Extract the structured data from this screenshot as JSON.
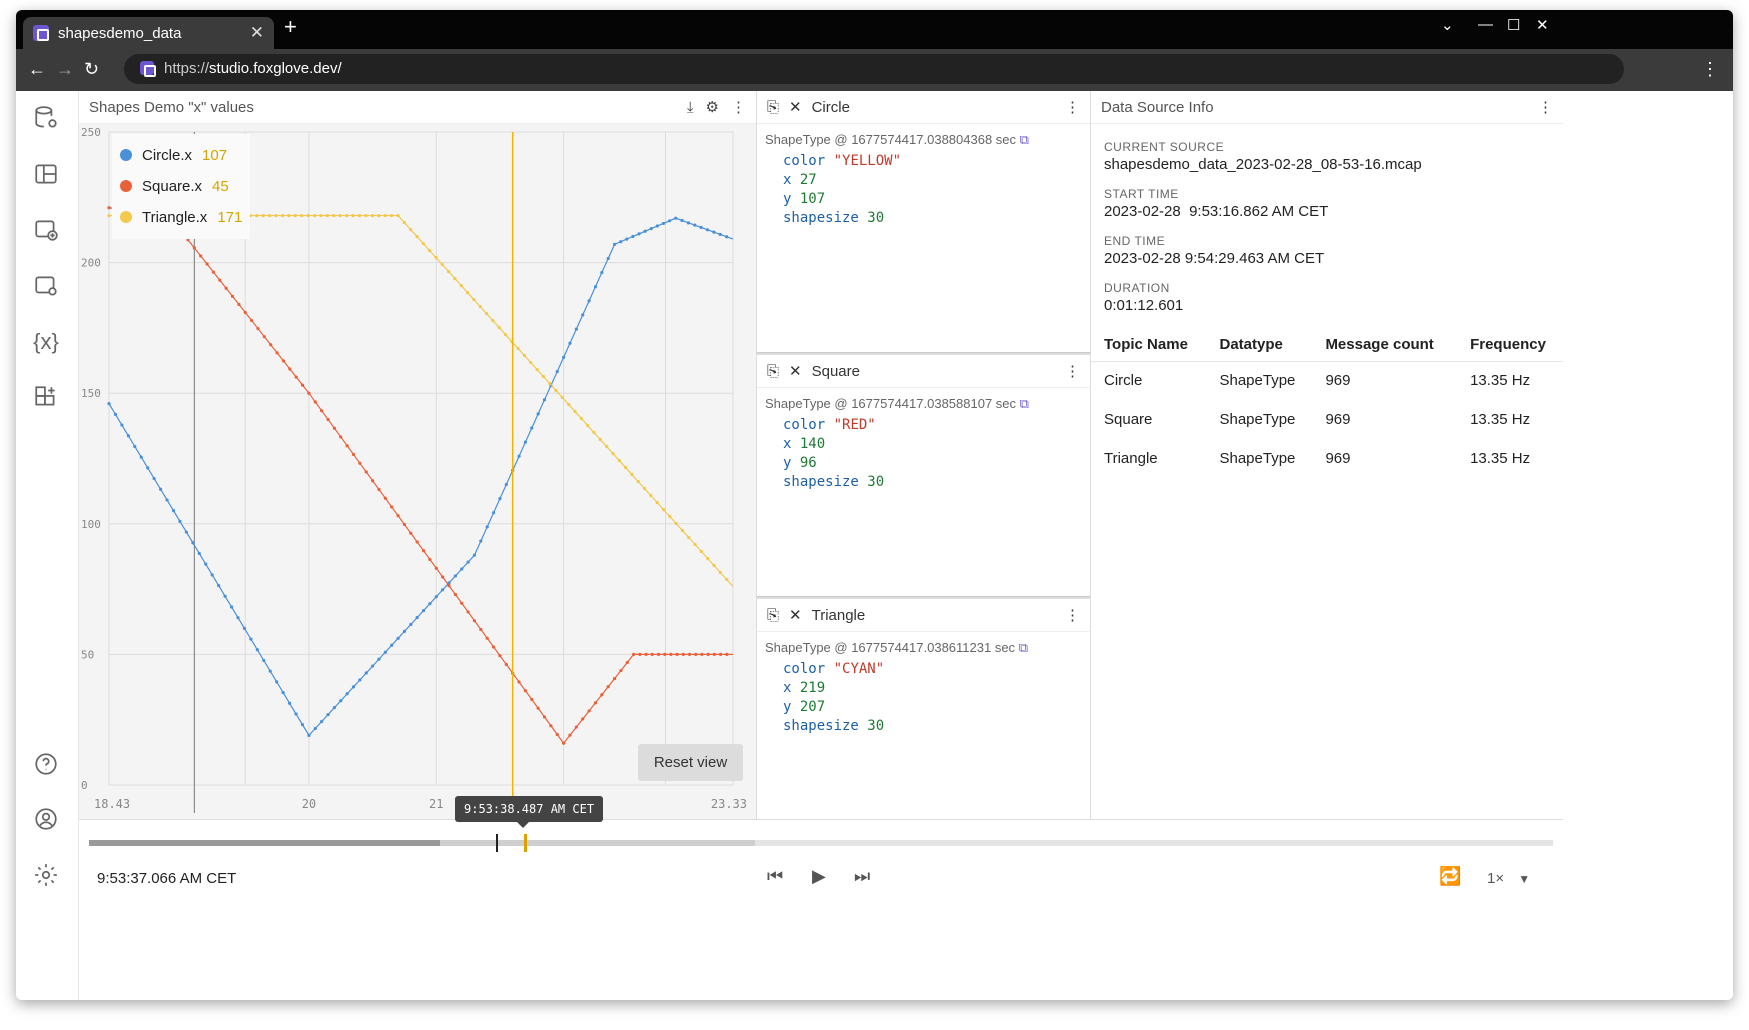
{
  "browser": {
    "tab_title": "shapesdemo_data",
    "url_prefix": "https://",
    "url_host": "studio.foxglove.dev/"
  },
  "plot": {
    "title": "Shapes Demo \"x\" values",
    "reset_label": "Reset view",
    "cursor_time": "9:53:38.487 AM CET",
    "legend": [
      {
        "name": "Circle.x",
        "value": "107",
        "color": "#4a90d9"
      },
      {
        "name": "Square.x",
        "value": "45",
        "color": "#e8613a"
      },
      {
        "name": "Triangle.x",
        "value": "171",
        "color": "#f2c94c"
      }
    ]
  },
  "chart_data": {
    "type": "line",
    "title": "Shapes Demo \"x\" values",
    "xlim": [
      18.43,
      23.33
    ],
    "ylim": [
      0,
      250
    ],
    "x_ticks": [
      "18.43",
      "20",
      "21",
      "23.33"
    ],
    "y_ticks": [
      "250",
      "200",
      "150",
      "100",
      "50",
      "0"
    ],
    "cursor_x": 21.6,
    "series": [
      {
        "name": "Circle.x",
        "color": "#4a90d9",
        "points": [
          [
            18.43,
            146
          ],
          [
            20.0,
            19
          ],
          [
            21.3,
            88
          ],
          [
            22.4,
            207
          ],
          [
            22.88,
            217
          ],
          [
            23.33,
            209
          ]
        ]
      },
      {
        "name": "Square.x",
        "color": "#e8613a",
        "points": [
          [
            18.43,
            221
          ],
          [
            18.9,
            218
          ],
          [
            20.0,
            150
          ],
          [
            22.0,
            16
          ],
          [
            22.55,
            50
          ],
          [
            23.33,
            50
          ]
        ]
      },
      {
        "name": "Triangle.x",
        "color": "#f2c94c",
        "points": [
          [
            18.43,
            218
          ],
          [
            20.7,
            218
          ],
          [
            23.33,
            76
          ]
        ]
      }
    ]
  },
  "messages": [
    {
      "topic": "Circle",
      "meta": "ShapeType @ 1677574417.038804368 sec",
      "fields": [
        [
          "color",
          "\"YELLOW\"",
          "s"
        ],
        [
          "x",
          "27",
          "n"
        ],
        [
          "y",
          "107",
          "n"
        ],
        [
          "shapesize",
          "30",
          "n"
        ]
      ]
    },
    {
      "topic": "Square",
      "meta": "ShapeType @ 1677574417.038588107 sec",
      "fields": [
        [
          "color",
          "\"RED\"",
          "s"
        ],
        [
          "x",
          "140",
          "n"
        ],
        [
          "y",
          "96",
          "n"
        ],
        [
          "shapesize",
          "30",
          "n"
        ]
      ]
    },
    {
      "topic": "Triangle",
      "meta": "ShapeType @ 1677574417.038611231 sec",
      "fields": [
        [
          "color",
          "\"CYAN\"",
          "s"
        ],
        [
          "x",
          "219",
          "n"
        ],
        [
          "y",
          "207",
          "n"
        ],
        [
          "shapesize",
          "30",
          "n"
        ]
      ]
    }
  ],
  "datasource": {
    "title": "Data Source Info",
    "current_source_label": "CURRENT SOURCE",
    "current_source": "shapesdemo_data_2023-02-28_08-53-16.mcap",
    "start_label": "START TIME",
    "start": "2023-02-28  9:53:16.862 AM CET",
    "end_label": "END TIME",
    "end": "2023-02-28 9:54:29.463 AM CET",
    "duration_label": "DURATION",
    "duration": "0:01:12.601",
    "headers": [
      "Topic Name",
      "Datatype",
      "Message count",
      "Frequency"
    ],
    "rows": [
      [
        "Circle",
        "ShapeType",
        "969",
        "13.35 Hz"
      ],
      [
        "Square",
        "ShapeType",
        "969",
        "13.35 Hz"
      ],
      [
        "Triangle",
        "ShapeType",
        "969",
        "13.35 Hz"
      ]
    ]
  },
  "playback": {
    "current_time": "9:53:37.066 AM CET",
    "speed": "1×",
    "buffered_fraction": 0.455,
    "progress_fraction": 0.24
  }
}
